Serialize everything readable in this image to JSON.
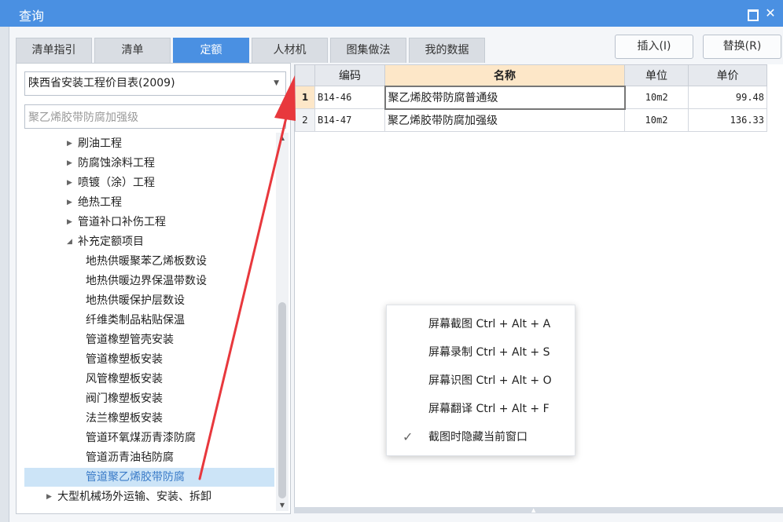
{
  "window": {
    "title": "查询"
  },
  "tabs": [
    {
      "label": "清单指引",
      "active": false
    },
    {
      "label": "清单",
      "active": false
    },
    {
      "label": "定额",
      "active": true
    },
    {
      "label": "人材机",
      "active": false
    },
    {
      "label": "图集做法",
      "active": false
    },
    {
      "label": "我的数据",
      "active": false
    }
  ],
  "actions": {
    "insert_label": "插入(I)",
    "replace_label": "替换(R)"
  },
  "left": {
    "library_selected": "陕西省安装工程价目表(2009)",
    "search_value": "聚乙烯胶带防腐加强级"
  },
  "tree": [
    {
      "label": "刷油工程",
      "level": 1,
      "expandable": true,
      "expanded": false,
      "selected": false
    },
    {
      "label": "防腐蚀涂料工程",
      "level": 1,
      "expandable": true,
      "expanded": false,
      "selected": false
    },
    {
      "label": "喷镀（涂）工程",
      "level": 1,
      "expandable": true,
      "expanded": false,
      "selected": false
    },
    {
      "label": "绝热工程",
      "level": 1,
      "expandable": true,
      "expanded": false,
      "selected": false
    },
    {
      "label": "管道补口补伤工程",
      "level": 1,
      "expandable": true,
      "expanded": false,
      "selected": false
    },
    {
      "label": "补充定额项目",
      "level": 1,
      "expandable": true,
      "expanded": true,
      "selected": false
    },
    {
      "label": "地热供暖聚苯乙烯板数设",
      "level": 2,
      "expandable": false,
      "selected": false
    },
    {
      "label": "地热供暖边界保温带数设",
      "level": 2,
      "expandable": false,
      "selected": false
    },
    {
      "label": "地热供暖保护层数设",
      "level": 2,
      "expandable": false,
      "selected": false
    },
    {
      "label": "纤维类制品粘贴保温",
      "level": 2,
      "expandable": false,
      "selected": false
    },
    {
      "label": "管道橡塑管壳安装",
      "level": 2,
      "expandable": false,
      "selected": false
    },
    {
      "label": "管道橡塑板安装",
      "level": 2,
      "expandable": false,
      "selected": false
    },
    {
      "label": "风管橡塑板安装",
      "level": 2,
      "expandable": false,
      "selected": false
    },
    {
      "label": "阀门橡塑板安装",
      "level": 2,
      "expandable": false,
      "selected": false
    },
    {
      "label": "法兰橡塑板安装",
      "level": 2,
      "expandable": false,
      "selected": false
    },
    {
      "label": "管道环氧煤沥青漆防腐",
      "level": 2,
      "expandable": false,
      "selected": false
    },
    {
      "label": "管道沥青油毡防腐",
      "level": 2,
      "expandable": false,
      "selected": false
    },
    {
      "label": "管道聚乙烯胶带防腐",
      "level": 2,
      "expandable": false,
      "selected": true
    },
    {
      "label": "大型机械场外运输、安装、拆卸",
      "level": 0,
      "expandable": true,
      "expanded": false,
      "selected": false
    }
  ],
  "grid": {
    "headers": {
      "code": "编码",
      "name": "名称",
      "unit": "单位",
      "price": "单价"
    },
    "rows": [
      {
        "num": "1",
        "code": "B14-46",
        "name": "聚乙烯胶带防腐普通级",
        "unit": "10m2",
        "price": "99.48",
        "current": true
      },
      {
        "num": "2",
        "code": "B14-47",
        "name": "聚乙烯胶带防腐加强级",
        "unit": "10m2",
        "price": "136.33",
        "current": false
      }
    ]
  },
  "context_menu": [
    {
      "label": "屏幕截图 Ctrl + Alt + A",
      "checked": false
    },
    {
      "label": "屏幕录制 Ctrl + Alt + S",
      "checked": false
    },
    {
      "label": "屏幕识图 Ctrl + Alt + O",
      "checked": false
    },
    {
      "label": "屏幕翻译 Ctrl + Alt + F",
      "checked": false
    },
    {
      "label": "截图时隐藏当前窗口",
      "checked": true
    }
  ],
  "colors": {
    "accent": "#4a90e2",
    "arrow": "#e8383d",
    "selection": "#cce4f7",
    "header_highlight": "#fde7c8"
  },
  "icons": {
    "maximize": "maximize-icon",
    "close": "close-icon",
    "dropdown": "chevron-down-icon",
    "check": "check-icon",
    "annotation": "red-arrow-annotation"
  }
}
